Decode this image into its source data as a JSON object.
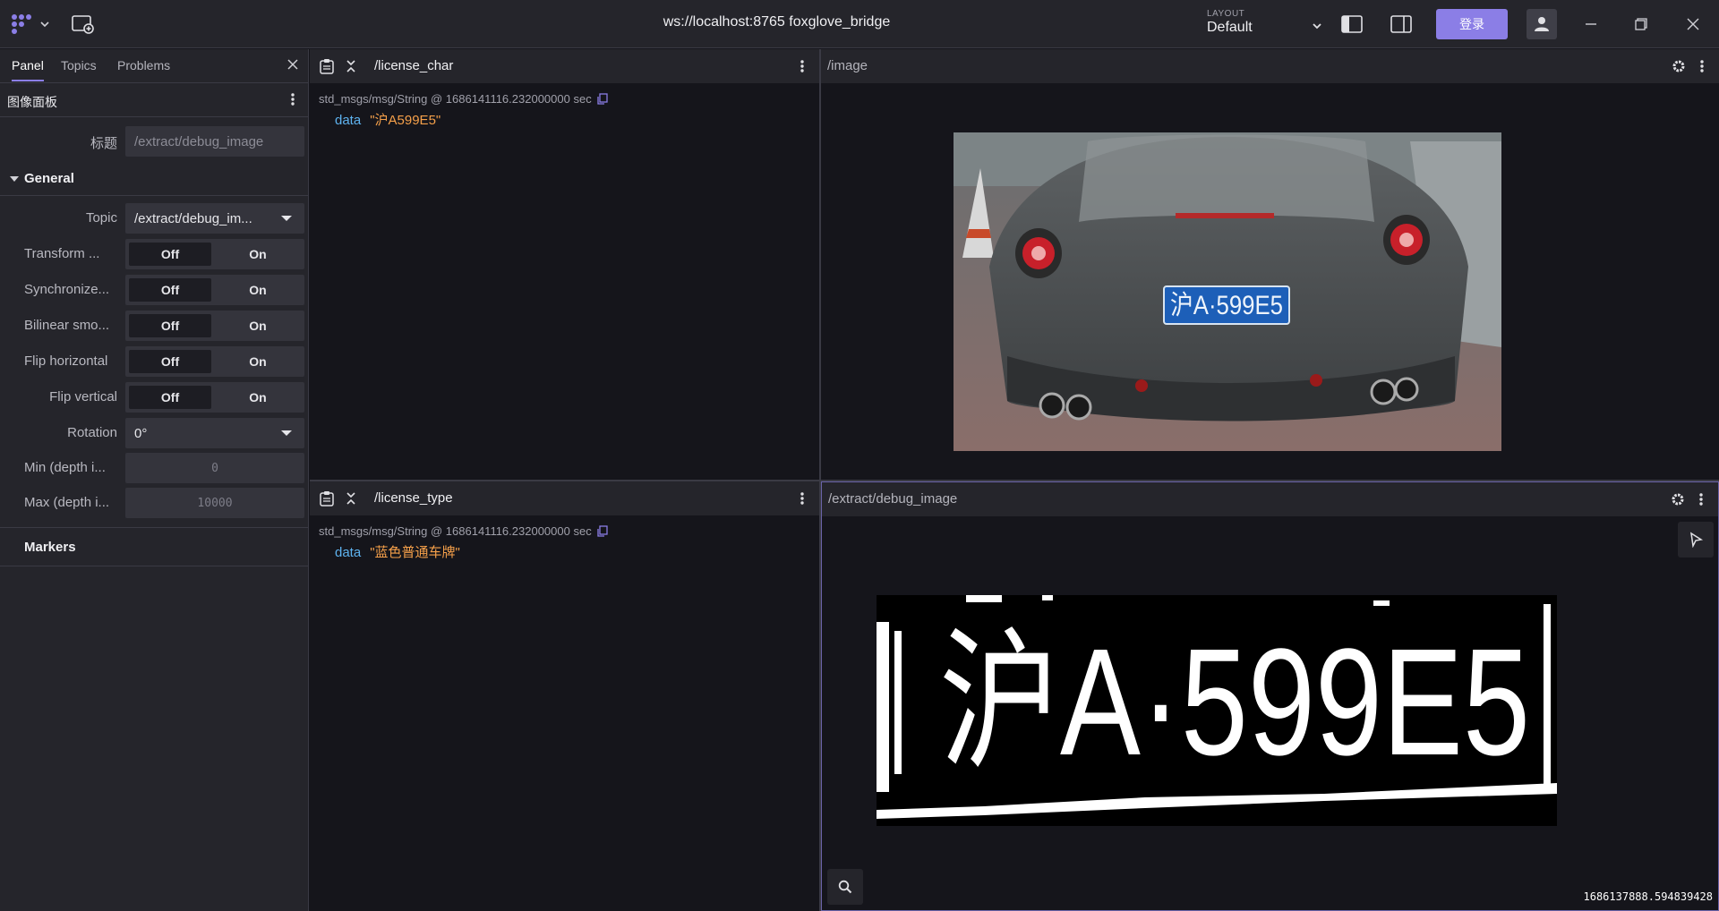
{
  "app": {
    "connection_title": "ws://localhost:8765 foxglove_bridge",
    "layout_label": "LAYOUT",
    "layout_value": "Default",
    "login_label": "登录"
  },
  "sidebar": {
    "tabs": [
      "Panel",
      "Topics",
      "Problems"
    ],
    "active_tab": "Panel",
    "panel_name": "图像面板",
    "title_label": "标题",
    "title_placeholder": "/extract/debug_image",
    "sections": {
      "general": "General",
      "markers": "Markers"
    },
    "topic_label": "Topic",
    "topic_value": "/extract/debug_im...",
    "toggles": [
      {
        "label": "Transform ...",
        "off": "Off",
        "on": "On",
        "selected": "Off"
      },
      {
        "label": "Synchronize...",
        "off": "Off",
        "on": "On",
        "selected": "Off"
      },
      {
        "label": "Bilinear smo...",
        "off": "Off",
        "on": "On",
        "selected": "Off"
      },
      {
        "label": "Flip horizontal",
        "off": "Off",
        "on": "On",
        "selected": "Off"
      },
      {
        "label": "Flip vertical",
        "off": "Off",
        "on": "On",
        "selected": "Off"
      }
    ],
    "rotation_label": "Rotation",
    "rotation_value": "0°",
    "min_depth_label": "Min (depth i...",
    "min_depth_value": "0",
    "max_depth_label": "Max (depth i...",
    "max_depth_value": "10000"
  },
  "panels": {
    "license_char": {
      "topic": "/license_char",
      "meta": "std_msgs/msg/String @ 1686141116.232000000 sec",
      "key": "data",
      "value": "\"沪A599E5\""
    },
    "license_type": {
      "topic": "/license_type",
      "meta": "std_msgs/msg/String @ 1686141116.232000000 sec",
      "key": "data",
      "value": "\"蓝色普通车牌\""
    },
    "image": {
      "topic": "/image",
      "plate_text": "沪A·599E5"
    },
    "debug_image": {
      "topic": "/extract/debug_image",
      "plate_text": "沪A·599E5",
      "timestamp": "1686137888.594839428"
    }
  },
  "colors": {
    "accent": "#8b7ee6",
    "value_string": "#f5a04a",
    "key": "#5eb3f0"
  }
}
